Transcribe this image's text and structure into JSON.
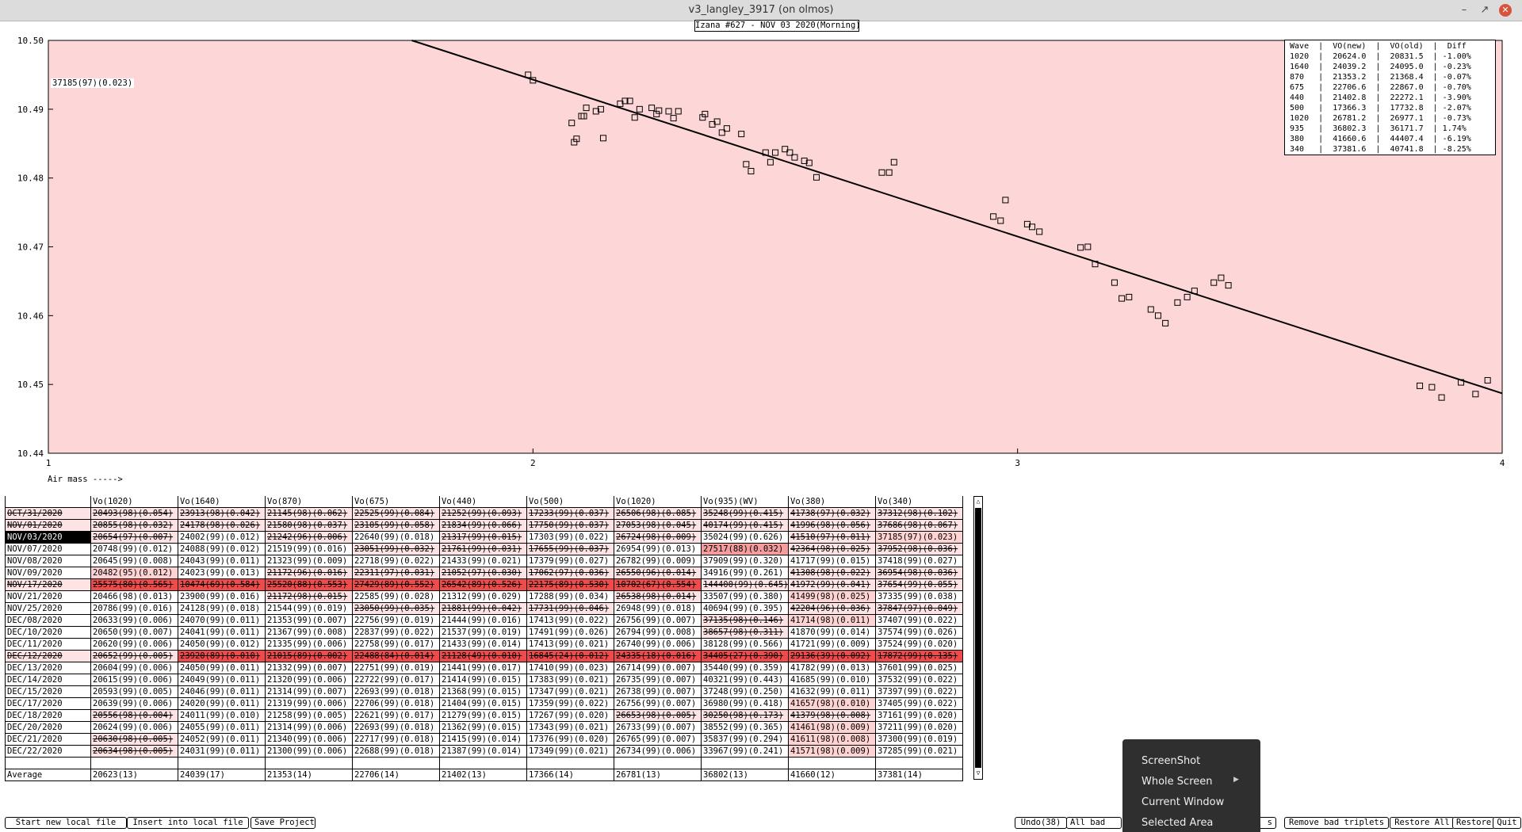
{
  "window": {
    "title": "v3_langley_3917 (on olmos)"
  },
  "plot": {
    "title": "Izana #627 - NOV 03 2020(Morning)",
    "readout": "37185(97)(0.023)",
    "xlabel": "Air mass ----->",
    "legend_header": "Wave  |  VO(new)  |  VO(old)  |  Diff",
    "legend_rows": [
      [
        "1020",
        "20624.0",
        "20831.5",
        "-1.00%"
      ],
      [
        "1640",
        "24039.2",
        "24095.0",
        "-0.23%"
      ],
      [
        "870",
        "21353.2",
        "21368.4",
        "-0.07%"
      ],
      [
        "675",
        "22706.6",
        "22867.0",
        "-0.70%"
      ],
      [
        "440",
        "21402.8",
        "22272.1",
        "-3.90%"
      ],
      [
        "500",
        "17366.3",
        "17732.8",
        "-2.07%"
      ],
      [
        "1020",
        "26781.2",
        "26977.1",
        "-0.73%"
      ],
      [
        "935",
        "36802.3",
        "36171.7",
        "1.74%"
      ],
      [
        "380",
        "41660.6",
        "44407.4",
        "-6.19%"
      ],
      [
        "340",
        "37381.6",
        "40741.8",
        "-8.25%"
      ]
    ]
  },
  "chart_data": {
    "type": "scatter",
    "title": "Izana #627 - NOV 03 2020(Morning)",
    "xlabel": "Air mass ----->",
    "ylabel": "",
    "xlim": [
      1,
      4
    ],
    "ylim": [
      10.44,
      10.5
    ],
    "x_ticks": [
      "1",
      "2",
      "3",
      "4"
    ],
    "y_ticks": [
      "10.44",
      "10.45",
      "10.46",
      "10.47",
      "10.48",
      "10.49",
      "10.50"
    ],
    "fit_line": {
      "x": [
        1.75,
        4.0
      ],
      "y": [
        10.5,
        10.4487
      ]
    },
    "points": [
      [
        1.99,
        10.495
      ],
      [
        2.0,
        10.4942
      ],
      [
        2.08,
        10.488
      ],
      [
        2.085,
        10.4852
      ],
      [
        2.09,
        10.4857
      ],
      [
        2.1,
        10.489
      ],
      [
        2.105,
        10.489
      ],
      [
        2.11,
        10.4902
      ],
      [
        2.13,
        10.4897
      ],
      [
        2.14,
        10.49
      ],
      [
        2.145,
        10.4858
      ],
      [
        2.18,
        10.4908
      ],
      [
        2.19,
        10.4912
      ],
      [
        2.2,
        10.4912
      ],
      [
        2.21,
        10.4888
      ],
      [
        2.22,
        10.49
      ],
      [
        2.245,
        10.4902
      ],
      [
        2.255,
        10.4893
      ],
      [
        2.26,
        10.4898
      ],
      [
        2.28,
        10.4897
      ],
      [
        2.29,
        10.4887
      ],
      [
        2.3,
        10.4897
      ],
      [
        2.35,
        10.4888
      ],
      [
        2.355,
        10.4893
      ],
      [
        2.37,
        10.4878
      ],
      [
        2.38,
        10.4882
      ],
      [
        2.39,
        10.4866
      ],
      [
        2.4,
        10.4872
      ],
      [
        2.43,
        10.4864
      ],
      [
        2.44,
        10.482
      ],
      [
        2.45,
        10.481
      ],
      [
        2.48,
        10.4837
      ],
      [
        2.49,
        10.4823
      ],
      [
        2.5,
        10.4837
      ],
      [
        2.52,
        10.4842
      ],
      [
        2.53,
        10.4837
      ],
      [
        2.54,
        10.483
      ],
      [
        2.56,
        10.4825
      ],
      [
        2.57,
        10.4822
      ],
      [
        2.585,
        10.4801
      ],
      [
        2.72,
        10.4808
      ],
      [
        2.735,
        10.4808
      ],
      [
        2.745,
        10.4823
      ],
      [
        2.95,
        10.4744
      ],
      [
        2.965,
        10.4738
      ],
      [
        2.975,
        10.4768
      ],
      [
        3.02,
        10.4733
      ],
      [
        3.03,
        10.4729
      ],
      [
        3.045,
        10.4722
      ],
      [
        3.13,
        10.4699
      ],
      [
        3.145,
        10.47
      ],
      [
        3.16,
        10.4675
      ],
      [
        3.2,
        10.4648
      ],
      [
        3.215,
        10.4625
      ],
      [
        3.23,
        10.4627
      ],
      [
        3.275,
        10.4609
      ],
      [
        3.29,
        10.46
      ],
      [
        3.305,
        10.4589
      ],
      [
        3.33,
        10.4619
      ],
      [
        3.35,
        10.4627
      ],
      [
        3.365,
        10.4636
      ],
      [
        3.405,
        10.4648
      ],
      [
        3.42,
        10.4655
      ],
      [
        3.435,
        10.4644
      ],
      [
        3.83,
        10.4498
      ],
      [
        3.855,
        10.4496
      ],
      [
        3.875,
        10.4481
      ],
      [
        3.915,
        10.4503
      ],
      [
        3.945,
        10.4486
      ],
      [
        3.97,
        10.4506
      ]
    ],
    "grid": false
  },
  "table": {
    "headers": [
      "",
      "Vo(1020)",
      "Vo(1640)",
      "Vo(870)",
      "Vo(675)",
      "Vo(440)",
      "Vo(500)",
      "Vo(1020)",
      "Vo(935)(WV)",
      "Vo(380)",
      "Vo(340)"
    ],
    "rows": [
      {
        "date": "OCT/31/2020",
        "strike": true,
        "cells": [
          "20493(98)(0.054)",
          "23913(98)(0.042)",
          "21145(98)(0.062)",
          "22525(99)(0.084)",
          "21252(99)(0.093)",
          "17233(99)(0.037)",
          "26506(98)(0.085)",
          "35248(99)(0.415)",
          "41738(97)(0.032)",
          "37312(98)(0.102)"
        ],
        "styles": [
          "s",
          "s",
          "s",
          "s",
          "s",
          "s",
          "s",
          "s",
          "s",
          "s"
        ]
      },
      {
        "date": "NOV/01/2020",
        "strike": true,
        "cells": [
          "20855(98)(0.032)",
          "24178(98)(0.026)",
          "21580(98)(0.037)",
          "23105(99)(0.058)",
          "21834(99)(0.066)",
          "17750(99)(0.037)",
          "27053(98)(0.045)",
          "40174(99)(0.415)",
          "41996(98)(0.056)",
          "37686(98)(0.067)"
        ],
        "styles": [
          "s",
          "s",
          "s",
          "s",
          "s",
          "s",
          "s",
          "s",
          "s",
          "s"
        ]
      },
      {
        "date": "NOV/03/2020",
        "selected": true,
        "cells": [
          "20654(97)(0.007)",
          "24002(99)(0.012)",
          "21242(96)(0.006)",
          "22640(99)(0.018)",
          "21317(99)(0.015)",
          "17303(99)(0.022)",
          "26724(98)(0.009)",
          "35024(99)(0.626)",
          "41510(97)(0.011)",
          "37185(97)(0.023)"
        ],
        "styles": [
          "s",
          "n",
          "s",
          "n",
          "s",
          "n",
          "s",
          "n",
          "s",
          "l"
        ]
      },
      {
        "date": "NOV/07/2020",
        "cells": [
          "20748(99)(0.012)",
          "24088(99)(0.012)",
          "21519(99)(0.016)",
          "23051(99)(0.032)",
          "21761(99)(0.031)",
          "17655(99)(0.037)",
          "26954(99)(0.013)",
          "27517(88)(0.032)",
          "42364(98)(0.025)",
          "37952(98)(0.036)"
        ],
        "styles": [
          "n",
          "n",
          "n",
          "s",
          "s",
          "s",
          "n",
          "m",
          "s",
          "s"
        ]
      },
      {
        "date": "NOV/08/2020",
        "cells": [
          "20645(99)(0.008)",
          "24043(99)(0.011)",
          "21323(99)(0.009)",
          "22718(99)(0.022)",
          "21433(99)(0.021)",
          "17379(99)(0.027)",
          "26782(99)(0.009)",
          "37909(99)(0.320)",
          "41717(99)(0.015)",
          "37418(99)(0.027)"
        ],
        "styles": [
          "n",
          "n",
          "n",
          "n",
          "n",
          "n",
          "n",
          "n",
          "n",
          "n"
        ]
      },
      {
        "date": "NOV/09/2020",
        "cells": [
          "20482(95)(0.012)",
          "24023(99)(0.013)",
          "21172(96)(0.016)",
          "22311(97)(0.031)",
          "21052(97)(0.030)",
          "17062(97)(0.036)",
          "26550(96)(0.014)",
          "34916(99)(0.261)",
          "41308(98)(0.022)",
          "36954(98)(0.036)"
        ],
        "styles": [
          "l",
          "n",
          "s",
          "s",
          "s",
          "s",
          "s",
          "n",
          "s",
          "s"
        ]
      },
      {
        "date": "NOV/17/2020",
        "strike": true,
        "cells": [
          "25575(80)(0.565)",
          "10474(69)(0.584)",
          "25520(88)(0.553)",
          "27429(89)(0.552)",
          "26542(89)(0.526)",
          "22175(89)(0.530)",
          "10702(67)(0.554)",
          "144400(99)(0.645)",
          "41972(99)(0.041)",
          "37654(99)(0.055)"
        ],
        "styles": [
          "d",
          "d",
          "d",
          "d",
          "d",
          "d",
          "d",
          "s",
          "s",
          "s"
        ]
      },
      {
        "date": "NOV/21/2020",
        "cells": [
          "20466(98)(0.013)",
          "23900(99)(0.016)",
          "21172(98)(0.015)",
          "22585(99)(0.028)",
          "21312(99)(0.029)",
          "17288(99)(0.034)",
          "26538(98)(0.014)",
          "33507(99)(0.380)",
          "41499(98)(0.025)",
          "37335(99)(0.038)"
        ],
        "styles": [
          "n",
          "n",
          "s",
          "n",
          "n",
          "n",
          "s",
          "n",
          "l",
          "n"
        ]
      },
      {
        "date": "NOV/25/2020",
        "cells": [
          "20786(99)(0.016)",
          "24128(99)(0.018)",
          "21544(99)(0.019)",
          "23050(99)(0.035)",
          "21881(99)(0.042)",
          "17731(99)(0.046)",
          "26948(99)(0.018)",
          "40694(99)(0.395)",
          "42204(96)(0.036)",
          "37847(97)(0.049)"
        ],
        "styles": [
          "n",
          "n",
          "n",
          "s",
          "s",
          "s",
          "n",
          "n",
          "s",
          "s"
        ]
      },
      {
        "date": "DEC/08/2020",
        "cells": [
          "20633(99)(0.006)",
          "24070(99)(0.011)",
          "21353(99)(0.007)",
          "22756(99)(0.019)",
          "21444(99)(0.016)",
          "17413(99)(0.022)",
          "26756(99)(0.007)",
          "37135(98)(0.146)",
          "41714(98)(0.011)",
          "37407(99)(0.022)"
        ],
        "styles": [
          "n",
          "n",
          "n",
          "n",
          "n",
          "n",
          "n",
          "s",
          "l",
          "n"
        ]
      },
      {
        "date": "DEC/10/2020",
        "cells": [
          "20650(99)(0.007)",
          "24041(99)(0.011)",
          "21367(99)(0.008)",
          "22837(99)(0.022)",
          "21537(99)(0.019)",
          "17491(99)(0.026)",
          "26794(99)(0.008)",
          "38657(98)(0.311)",
          "41870(99)(0.014)",
          "37574(99)(0.026)"
        ],
        "styles": [
          "n",
          "n",
          "n",
          "n",
          "n",
          "n",
          "n",
          "s",
          "n",
          "n"
        ]
      },
      {
        "date": "DEC/11/2020",
        "cells": [
          "20620(99)(0.006)",
          "24050(99)(0.012)",
          "21335(99)(0.006)",
          "22758(99)(0.017)",
          "21433(99)(0.014)",
          "17413(99)(0.021)",
          "26740(99)(0.006)",
          "38128(99)(0.566)",
          "41721(99)(0.009)",
          "37524(99)(0.020)"
        ],
        "styles": [
          "n",
          "n",
          "n",
          "n",
          "n",
          "n",
          "n",
          "n",
          "n",
          "n"
        ]
      },
      {
        "date": "DEC/12/2020",
        "strike": true,
        "cells": [
          "20652(99)(0.005)",
          "23920(89)(0.010)",
          "21015(89)(0.002)",
          "22488(84)(0.014)",
          "21128(49)(0.010)",
          "16845(24)(0.012)",
          "24335(18)(0.016)",
          "34405(27)(0.390)",
          "29136(39)(0.092)",
          "17872(99)(0.135)"
        ],
        "styles": [
          "s",
          "d",
          "d",
          "d",
          "d",
          "d",
          "d",
          "d",
          "d",
          "d"
        ]
      },
      {
        "date": "DEC/13/2020",
        "cells": [
          "20604(99)(0.006)",
          "24050(99)(0.011)",
          "21332(99)(0.007)",
          "22751(99)(0.019)",
          "21441(99)(0.017)",
          "17410(99)(0.023)",
          "26714(99)(0.007)",
          "35440(99)(0.359)",
          "41782(99)(0.013)",
          "37601(99)(0.025)"
        ],
        "styles": [
          "n",
          "n",
          "n",
          "n",
          "n",
          "n",
          "n",
          "n",
          "n",
          "n"
        ]
      },
      {
        "date": "DEC/14/2020",
        "cells": [
          "20615(99)(0.006)",
          "24049(99)(0.011)",
          "21320(99)(0.006)",
          "22722(99)(0.017)",
          "21414(99)(0.015)",
          "17383(99)(0.021)",
          "26735(99)(0.007)",
          "40321(99)(0.443)",
          "41685(99)(0.010)",
          "37532(99)(0.022)"
        ],
        "styles": [
          "n",
          "n",
          "n",
          "n",
          "n",
          "n",
          "n",
          "n",
          "n",
          "n"
        ]
      },
      {
        "date": "DEC/15/2020",
        "cells": [
          "20593(99)(0.005)",
          "24046(99)(0.011)",
          "21314(99)(0.007)",
          "22693(99)(0.018)",
          "21368(99)(0.015)",
          "17347(99)(0.021)",
          "26738(99)(0.007)",
          "37248(99)(0.250)",
          "41632(99)(0.011)",
          "37397(99)(0.022)"
        ],
        "styles": [
          "n",
          "n",
          "n",
          "n",
          "n",
          "n",
          "n",
          "n",
          "n",
          "n"
        ]
      },
      {
        "date": "DEC/17/2020",
        "cells": [
          "20639(99)(0.006)",
          "24020(99)(0.011)",
          "21319(99)(0.006)",
          "22706(99)(0.018)",
          "21404(99)(0.015)",
          "17359(99)(0.022)",
          "26756(99)(0.007)",
          "36980(99)(0.418)",
          "41657(98)(0.010)",
          "37405(99)(0.022)"
        ],
        "styles": [
          "n",
          "n",
          "n",
          "n",
          "n",
          "n",
          "n",
          "n",
          "l",
          "n"
        ]
      },
      {
        "date": "DEC/18/2020",
        "cells": [
          "20556(98)(0.004)",
          "24011(99)(0.010)",
          "21258(99)(0.005)",
          "22621(99)(0.017)",
          "21279(99)(0.015)",
          "17267(99)(0.020)",
          "26653(98)(0.005)",
          "30250(98)(0.173)",
          "41379(98)(0.008)",
          "37161(99)(0.020)"
        ],
        "styles": [
          "s",
          "n",
          "n",
          "n",
          "n",
          "n",
          "s",
          "s",
          "s",
          "n"
        ]
      },
      {
        "date": "DEC/20/2020",
        "cells": [
          "20624(99)(0.006)",
          "24055(99)(0.011)",
          "21314(99)(0.006)",
          "22693(99)(0.018)",
          "21362(99)(0.015)",
          "17343(99)(0.021)",
          "26733(99)(0.007)",
          "38552(99)(0.365)",
          "41461(98)(0.009)",
          "37211(99)(0.020)"
        ],
        "styles": [
          "n",
          "n",
          "n",
          "n",
          "n",
          "n",
          "n",
          "n",
          "l",
          "n"
        ]
      },
      {
        "date": "DEC/21/2020",
        "cells": [
          "20630(98)(0.005)",
          "24052(99)(0.011)",
          "21340(99)(0.006)",
          "22717(99)(0.018)",
          "21415(99)(0.014)",
          "17376(99)(0.020)",
          "26765(99)(0.007)",
          "35837(99)(0.294)",
          "41611(98)(0.008)",
          "37300(99)(0.019)"
        ],
        "styles": [
          "s",
          "n",
          "n",
          "n",
          "n",
          "n",
          "n",
          "n",
          "l",
          "n"
        ]
      },
      {
        "date": "DEC/22/2020",
        "cells": [
          "20634(98)(0.005)",
          "24031(99)(0.011)",
          "21300(99)(0.006)",
          "22688(99)(0.018)",
          "21387(99)(0.014)",
          "17349(99)(0.021)",
          "26734(99)(0.006)",
          "33967(99)(0.241)",
          "41571(98)(0.009)",
          "37285(99)(0.021)"
        ],
        "styles": [
          "s",
          "n",
          "n",
          "n",
          "n",
          "n",
          "n",
          "n",
          "l",
          "n"
        ]
      }
    ],
    "average": {
      "label": "Average",
      "cells": [
        "20623(13)",
        "24039(17)",
        "21353(14)",
        "22706(14)",
        "21402(13)",
        "17366(14)",
        "26781(13)",
        "36802(13)",
        "41660(12)",
        "37381(14)"
      ]
    }
  },
  "buttons_left": [
    "Start new local file",
    "Insert into local file",
    "Save Project"
  ],
  "buttons_right": {
    "undo": "Undo(38)",
    "all_bad": "All bad",
    "hidden_s": "s",
    "remove_bad": "Remove bad triplets",
    "restore_all": "Restore All",
    "restore": "Restore",
    "quit": "Quit"
  },
  "context_menu": {
    "items": [
      "ScreenShot",
      "Whole Screen",
      "Current Window",
      "Selected Area"
    ]
  },
  "colors": {
    "plot_bg": "#fdd7d7",
    "light": "#fdd3d3",
    "mid": "#f59d9d",
    "dark": "#f04b4b",
    "menu_bg": "#2f2f2f"
  }
}
